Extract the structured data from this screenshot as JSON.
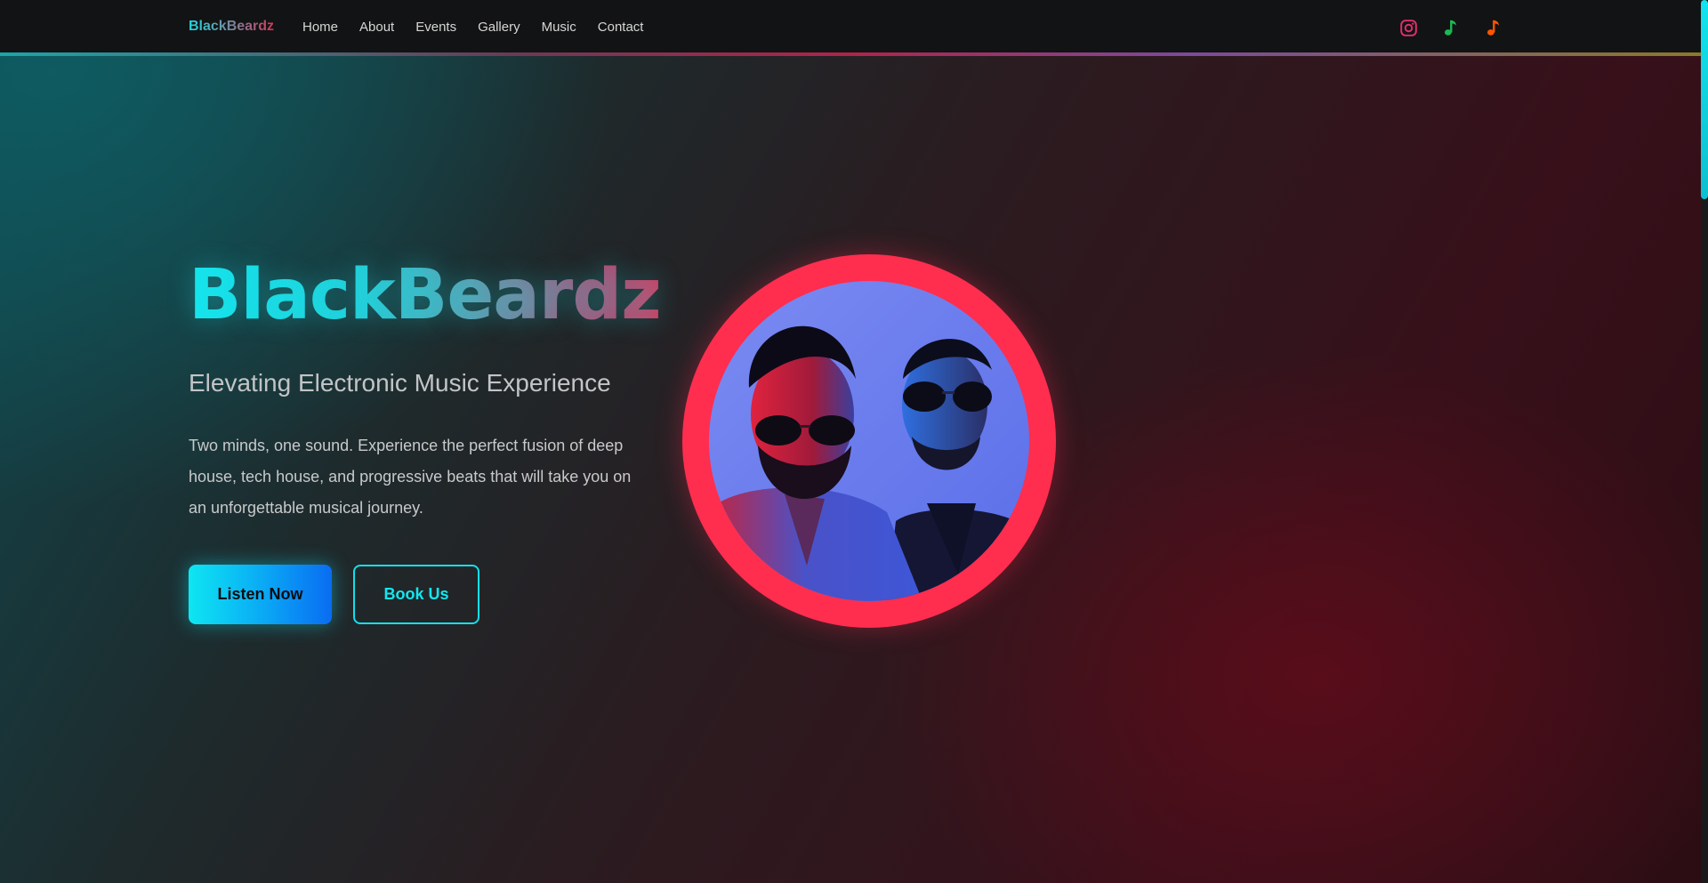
{
  "nav": {
    "brand": "BlackBeardz",
    "links": [
      "Home",
      "About",
      "Events",
      "Gallery",
      "Music",
      "Contact"
    ],
    "socials": [
      {
        "icon": "instagram-icon",
        "color": "#e1306c"
      },
      {
        "icon": "spotify-note-icon",
        "color": "#1db954"
      },
      {
        "icon": "soundcloud-note-icon",
        "color": "#ff5500"
      }
    ]
  },
  "hero": {
    "title": "BlackBeardz",
    "subtitle": "Elevating Electronic Music Experience",
    "description": "Two minds, one sound. Experience the perfect fusion of deep house, tech house, and progressive beats that will take you on an unforgettable musical journey.",
    "primary_button": "Listen Now",
    "secondary_button": "Book Us",
    "image_label": "Two DJs wearing sunglasses under red and blue neon lighting"
  },
  "colors": {
    "accent_cyan": "#12e6ef",
    "accent_red": "#ff2e4f",
    "navbar_bg": "#121314"
  }
}
